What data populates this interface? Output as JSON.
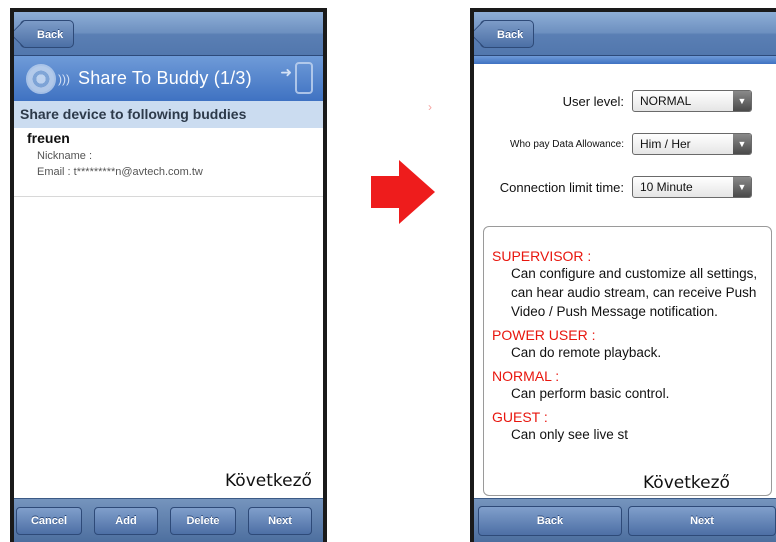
{
  "left": {
    "back_label": "Back",
    "title": "Share To Buddy (1/3)",
    "subheader": "Share device to following buddies",
    "buddy": {
      "name": "freuen",
      "nickname": "Nickname :",
      "email": "Email : t*********n@avtech.com.tw"
    },
    "caption": "Következő",
    "toolbar": {
      "cancel": "Cancel",
      "add": "Add",
      "delete": "Delete",
      "next": "Next"
    }
  },
  "right": {
    "back_label": "Back",
    "form": {
      "user_level_label": "User level:",
      "user_level_value": "NORMAL",
      "pay_label": "Who pay Data Allowance:",
      "pay_value": "Him / Her",
      "limit_label": "Connection limit time:",
      "limit_value": "10 Minute"
    },
    "roles": [
      {
        "title": "SUPERVISOR :",
        "desc": "Can configure and customize all settings, can hear audio stream, can receive Push Video / Push Message notification."
      },
      {
        "title": "POWER USER :",
        "desc": "Can do remote playback."
      },
      {
        "title": "NORMAL :",
        "desc": "Can perform basic control."
      },
      {
        "title": "GUEST :",
        "desc": "Can only see live st"
      }
    ],
    "caption": "Következő",
    "toolbar": {
      "back": "Back",
      "next": "Next"
    }
  },
  "colors": {
    "accent_red": "#e8160e",
    "nav_blue": "#5a7fb4",
    "arrow_red": "#ee1c1c"
  },
  "icons": [
    "back-arrow-icon",
    "camera-icon",
    "signal-waves-icon",
    "share-arrow-icon",
    "phone-icon",
    "dropdown-arrow-icon",
    "right-arrow-icon"
  ]
}
